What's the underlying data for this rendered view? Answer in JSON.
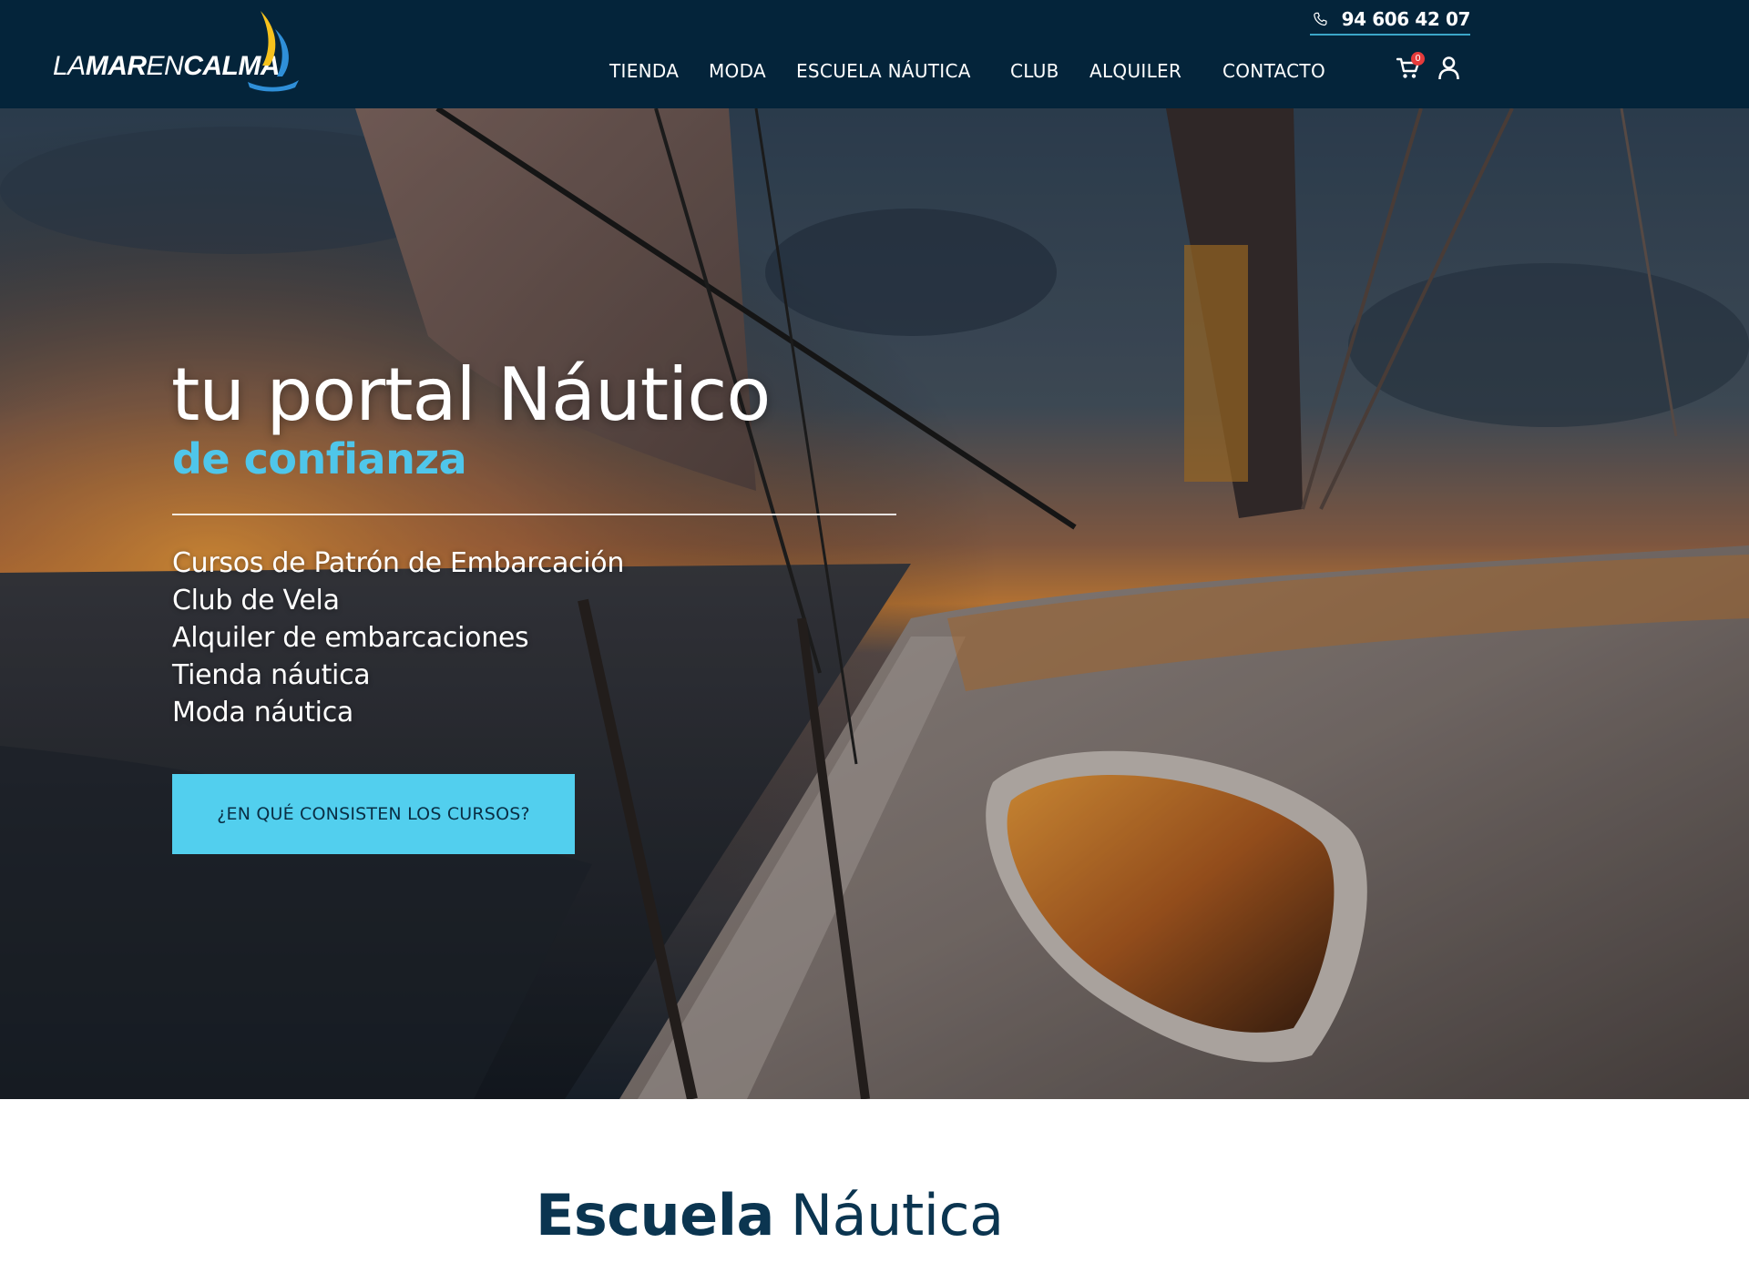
{
  "header": {
    "logo": {
      "text_prefix": "LA",
      "text_mid": "MAR",
      "text_en": "EN",
      "text_end": "CALMA"
    },
    "phone": {
      "icon": "phone-icon",
      "number": "94 606 42 07"
    },
    "nav": [
      {
        "label": "TIENDA"
      },
      {
        "label": "MODA"
      },
      {
        "label": "ESCUELA NÁUTICA"
      },
      {
        "label": "CLUB"
      },
      {
        "label": "ALQUILER"
      },
      {
        "label": "CONTACTO"
      }
    ],
    "cart": {
      "icon": "cart-icon",
      "count": "0"
    },
    "account": {
      "icon": "user-icon"
    }
  },
  "hero": {
    "title": "tu portal Náutico",
    "subtitle": "de confianza",
    "services": [
      "Cursos de Patrón de Embarcación",
      "Club de Vela",
      "Alquiler de embarcaciones",
      "Tienda náutica",
      "Moda náutica"
    ],
    "cta_label": "¿EN QUÉ CONSISTEN LOS CURSOS?"
  },
  "section": {
    "title_strong": "Escuela",
    "title_light": "Náutica"
  },
  "colors": {
    "header_bg": "#04243a",
    "accent": "#52cfee",
    "subtitle": "#4fc6ea",
    "section_title": "#0b3550",
    "badge": "#e63b3b"
  }
}
